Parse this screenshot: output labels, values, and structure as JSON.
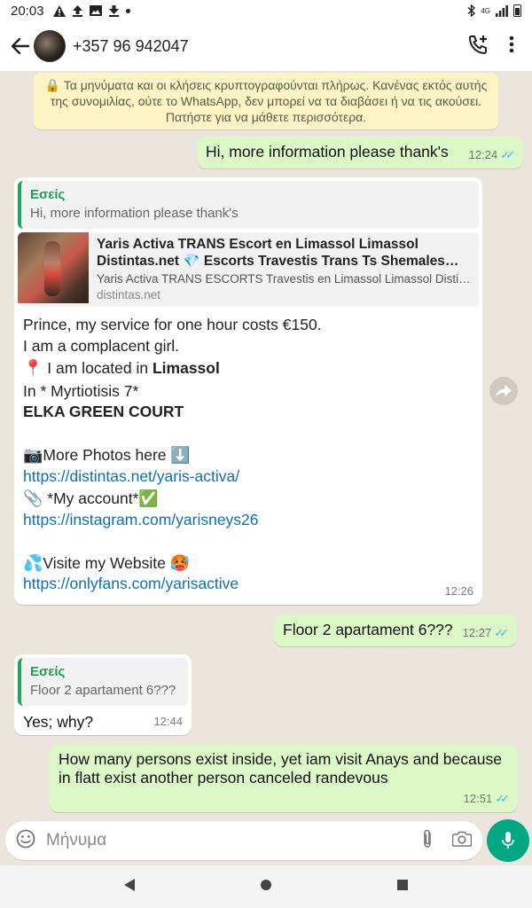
{
  "status_bar": {
    "time": "20:03",
    "left_icons": [
      "warning-icon",
      "upload-icon",
      "image-icon",
      "download-icon",
      "dot-icon"
    ],
    "network": "4G"
  },
  "header": {
    "contact": "+357 96 942047"
  },
  "encryption_notice": "🔒 Τα μηνύματα και οι κλήσεις κρυπτογραφούνται πλήρως. Κανένας εκτός αυτής της συνομιλίας, ούτε το WhatsApp, δεν μπορεί να τα διαβάσει ή να τις ακούσει. Πατήστε για να μάθετε περισσότερα.",
  "messages": {
    "m1": {
      "text": "Hi, more information please thank's",
      "time": "12:24"
    },
    "m2": {
      "quote_author": "Εσείς",
      "quote_text": "Hi, more information please thank's",
      "preview_title": "Yaris Activa TRANS Escort en Limassol Limassol Distintas.net 💎 Escorts Travestis Trans Ts Shemales Ac…",
      "preview_desc": "Yaris Activa TRANS ESCORTS Travestis en Limassol Limassol Disti…",
      "preview_domain": "distintas.net",
      "line1": "Prince, my service for one hour costs €150.",
      "line2": "I am a complacent girl.",
      "line3_emoji": "📍",
      "line3_text": " I am located in ",
      "line3_bold": "Limassol",
      "line4": "In * Myrtiotisis 7*",
      "line5": "ELKA GREEN COURT",
      "line6_emoji": "📷",
      "line6_text": "More Photos here ",
      "line6_emoji2": "⬇️",
      "link1": "https://distintas.net/yaris-activa/",
      "line7_emoji": "📎",
      "line7_text": " *My account*",
      "line7_emoji2": "✅",
      "link2": "https://instagram.com/yarisneys26",
      "line8_emoji": "💦",
      "line8_text": "Visite my Website ",
      "line8_emoji2": "🥵",
      "link3": "https://onlyfans.com/yarisactive",
      "time": "12:26"
    },
    "m3": {
      "text": "Floor 2 apartament 6???",
      "time": "12:27"
    },
    "m4": {
      "quote_author": "Εσείς",
      "quote_text": "Floor 2 apartament 6???",
      "text": "Yes; why?",
      "time": "12:44"
    },
    "m5": {
      "text": "How many persons exist inside, yet iam visit Anays and because in flatt exist another person canceled randevous",
      "time": "12:51"
    }
  },
  "input": {
    "placeholder": "Μήνυμα"
  },
  "colors": {
    "outgoing": "#dcf8c6",
    "incoming": "#ffffff",
    "accent": "#00a884",
    "link": "#0b6fb8",
    "read_ticks": "#34b7f1"
  }
}
